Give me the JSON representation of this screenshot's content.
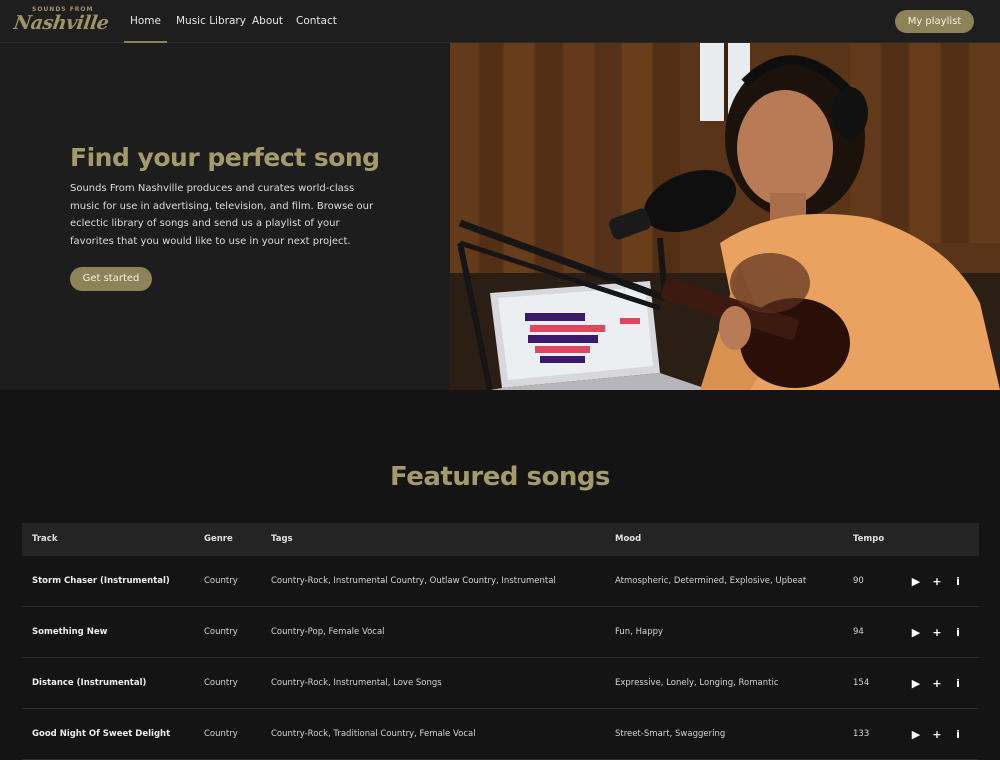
{
  "brand": {
    "logo_small": "SOUNDS FROM",
    "logo_script": "Nashville"
  },
  "nav": {
    "items": [
      "Home",
      "Music Library",
      "About",
      "Contact"
    ],
    "active": "Home",
    "playlist_button": "My playlist"
  },
  "hero": {
    "title": "Find your perfect song",
    "text": "Sounds From Nashville produces and curates world-class music for use in advertising, television, and film. Browse our eclectic library of songs and send us a playlist of your favorites that you would like to use in your next project.",
    "cta": "Get started",
    "image": "singer-with-guitar-and-microphone-photo"
  },
  "featured": {
    "title": "Featured songs",
    "columns": [
      "Track",
      "Genre",
      "Tags",
      "Mood",
      "Tempo"
    ],
    "rows": [
      {
        "track": "Storm Chaser (Instrumental)",
        "genre": "Country",
        "tags": "Country-Rock, Instrumental Country, Outlaw Country, Instrumental",
        "mood": "Atmospheric, Determined, Explosive, Upbeat",
        "tempo": "90"
      },
      {
        "track": "Something New",
        "genre": "Country",
        "tags": "Country-Pop, Female Vocal",
        "mood": "Fun, Happy",
        "tempo": "94"
      },
      {
        "track": "Distance (Instrumental)",
        "genre": "Country",
        "tags": "Country-Rock, Instrumental, Love Songs",
        "mood": "Expressive, Lonely, Longing, Romantic",
        "tempo": "154"
      },
      {
        "track": "Good Night Of Sweet Delight",
        "genre": "Country",
        "tags": "Country-Rock, Traditional Country, Female Vocal",
        "mood": "Street-Smart, Swaggering",
        "tempo": "133"
      }
    ],
    "row_actions": [
      {
        "icon": "play-icon",
        "glyph": "▶"
      },
      {
        "icon": "plus-icon",
        "glyph": "+"
      },
      {
        "icon": "info-icon",
        "glyph": "i"
      }
    ]
  },
  "colors": {
    "accent": "#8d8358",
    "accent_text": "#a59a6a",
    "background": "#141414",
    "header": "#1e1e1e"
  }
}
